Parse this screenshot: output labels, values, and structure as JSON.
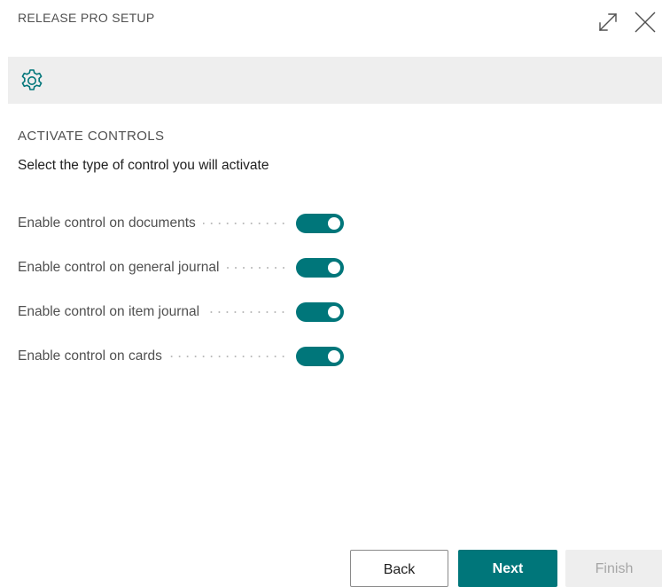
{
  "dialog": {
    "title": "RELEASE PRO SETUP"
  },
  "icons": {
    "expand": "expand-icon",
    "close": "close-icon",
    "settings": "gear-icon"
  },
  "section": {
    "title": "ACTIVATE CONTROLS",
    "instructions": "Select the type of control you will activate"
  },
  "fields": [
    {
      "label": "Enable control on documents",
      "enabled": true
    },
    {
      "label": "Enable control on general journal",
      "enabled": true
    },
    {
      "label": "Enable control on item journal",
      "enabled": true
    },
    {
      "label": "Enable control on cards",
      "enabled": true
    }
  ],
  "footer": {
    "back_label": "Back",
    "next_label": "Next",
    "finish_label": "Finish"
  },
  "colors": {
    "accent": "#00767a",
    "toolbar_bg": "#eeeeee",
    "disabled_text": "#a6a6a6"
  }
}
